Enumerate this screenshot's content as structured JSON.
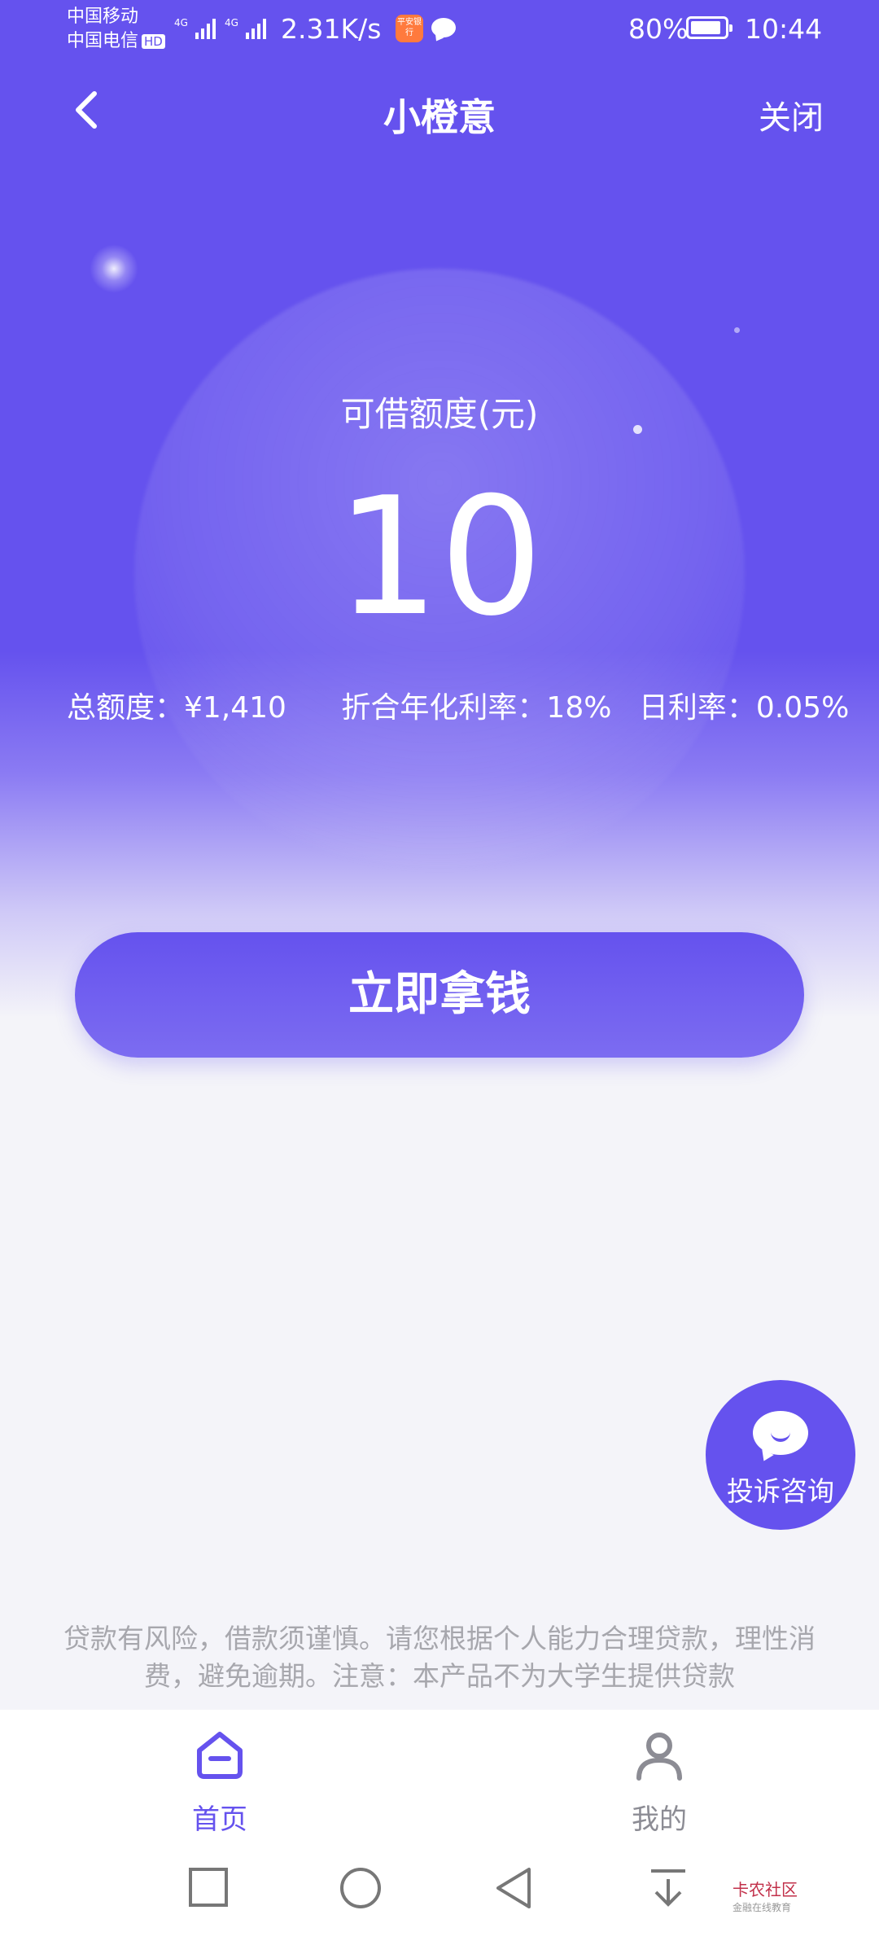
{
  "status_bar": {
    "carrier1": "中国移动",
    "carrier2": "中国电信",
    "hd": "HD",
    "net_speed": "2.31K/s",
    "app_badge": "平安银行",
    "battery_pct": "80%",
    "battery_level": 0.8,
    "time": "10:44"
  },
  "header": {
    "title": "小橙意",
    "close": "关闭"
  },
  "credit": {
    "label": "可借额度(元)",
    "amount": "10",
    "total": "总额度：¥1,410",
    "annual_rate": "折合年化利率：18%",
    "daily_rate": "日利率：0.05%"
  },
  "cta": "立即拿钱",
  "complaint": "投诉咨询",
  "disclaimer": {
    "line1": "贷款有风险，借款须谨慎。请您根据个人能力合理贷款，理性消",
    "line2": "费，避免逾期。注意：本产品不为大学生提供贷款"
  },
  "tabs": {
    "home": "首页",
    "mine": "我的"
  },
  "watermark": {
    "name": "卡农社区",
    "sub": "金融在线教育"
  },
  "colors": {
    "brand": "#6552ee"
  }
}
